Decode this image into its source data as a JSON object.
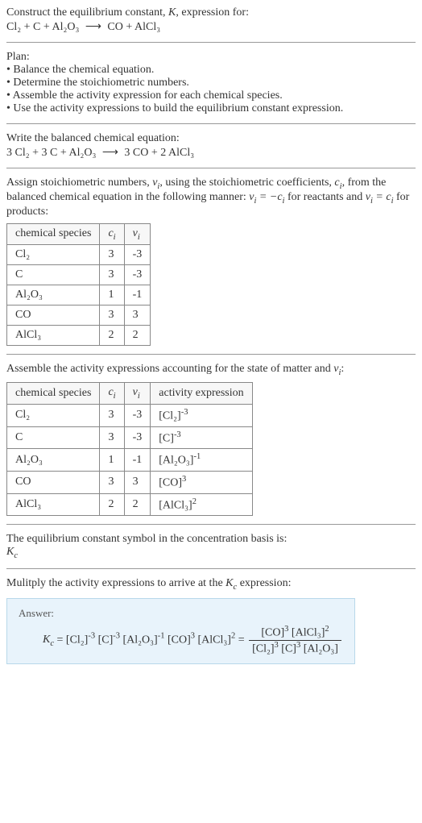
{
  "prompt": {
    "line1_a": "Construct the equilibrium constant, ",
    "line1_b": ", expression for:",
    "unbalanced_reactants": "Cl₂ + C + Al₂O₃",
    "unbalanced_products": "CO + AlCl₃"
  },
  "plan": {
    "header": "Plan:",
    "b1": "• Balance the chemical equation.",
    "b2": "• Determine the stoichiometric numbers.",
    "b3": "• Assemble the activity expression for each chemical species.",
    "b4": "• Use the activity expressions to build the equilibrium constant expression."
  },
  "balanced": {
    "header": "Write the balanced chemical equation:",
    "reactants": "3 Cl₂ + 3 C + Al₂O₃",
    "products": "3 CO + 2 AlCl₃"
  },
  "assign": {
    "line1_a": "Assign stoichiometric numbers, ",
    "line1_b": ", using the stoichiometric coefficients, ",
    "line1_c": ", from the balanced chemical equation in the following manner: ",
    "line1_d": " for reactants and ",
    "line1_e": " for products:"
  },
  "table1": {
    "h1": "chemical species",
    "rows": [
      {
        "sp": "Cl₂",
        "c": "3",
        "v": "-3"
      },
      {
        "sp": "C",
        "c": "3",
        "v": "-3"
      },
      {
        "sp": "Al₂O₃",
        "c": "1",
        "v": "-1"
      },
      {
        "sp": "CO",
        "c": "3",
        "v": "3"
      },
      {
        "sp": "AlCl₃",
        "c": "2",
        "v": "2"
      }
    ]
  },
  "assemble": {
    "line_a": "Assemble the activity expressions accounting for the state of matter and ",
    "line_b": ":"
  },
  "table2": {
    "h1": "chemical species",
    "h4": "activity expression",
    "rows": [
      {
        "sp": "Cl₂",
        "c": "3",
        "v": "-3",
        "ae_base": "[Cl₂]",
        "ae_exp": "-3"
      },
      {
        "sp": "C",
        "c": "3",
        "v": "-3",
        "ae_base": "[C]",
        "ae_exp": "-3"
      },
      {
        "sp": "Al₂O₃",
        "c": "1",
        "v": "-1",
        "ae_base": "[Al₂O₃]",
        "ae_exp": "-1"
      },
      {
        "sp": "CO",
        "c": "3",
        "v": "3",
        "ae_base": "[CO]",
        "ae_exp": "3"
      },
      {
        "sp": "AlCl₃",
        "c": "2",
        "v": "2",
        "ae_base": "[AlCl₃]",
        "ae_exp": "2"
      }
    ]
  },
  "ksymbol": {
    "line": "The equilibrium constant symbol in the concentration basis is:"
  },
  "multiply": {
    "line_a": "Mulitply the activity expressions to arrive at the ",
    "line_b": " expression:"
  },
  "answer": {
    "label": "Answer:",
    "eq_part": " = [Cl₂]",
    "exp1": "-3",
    "br2": " [C]",
    "exp2": "-3",
    "br3": " [Al₂O₃]",
    "exp3": "-1",
    "br4": " [CO]",
    "exp4": "3",
    "br5": " [AlCl₃]",
    "exp5": "2",
    "equals": " = ",
    "num1": "[CO]",
    "nexp1": "3",
    "num2": " [AlCl₃]",
    "nexp2": "2",
    "den1": "[Cl₂]",
    "dexp1": "3",
    "den2": " [C]",
    "dexp2": "3",
    "den3": " [Al₂O₃]"
  },
  "sym": {
    "K": "K",
    "Kc": "K",
    "c": "c",
    "nu": "ν",
    "ci": "c",
    "i": "i",
    "eq_neg": " = −",
    "eq_pos": " = "
  }
}
